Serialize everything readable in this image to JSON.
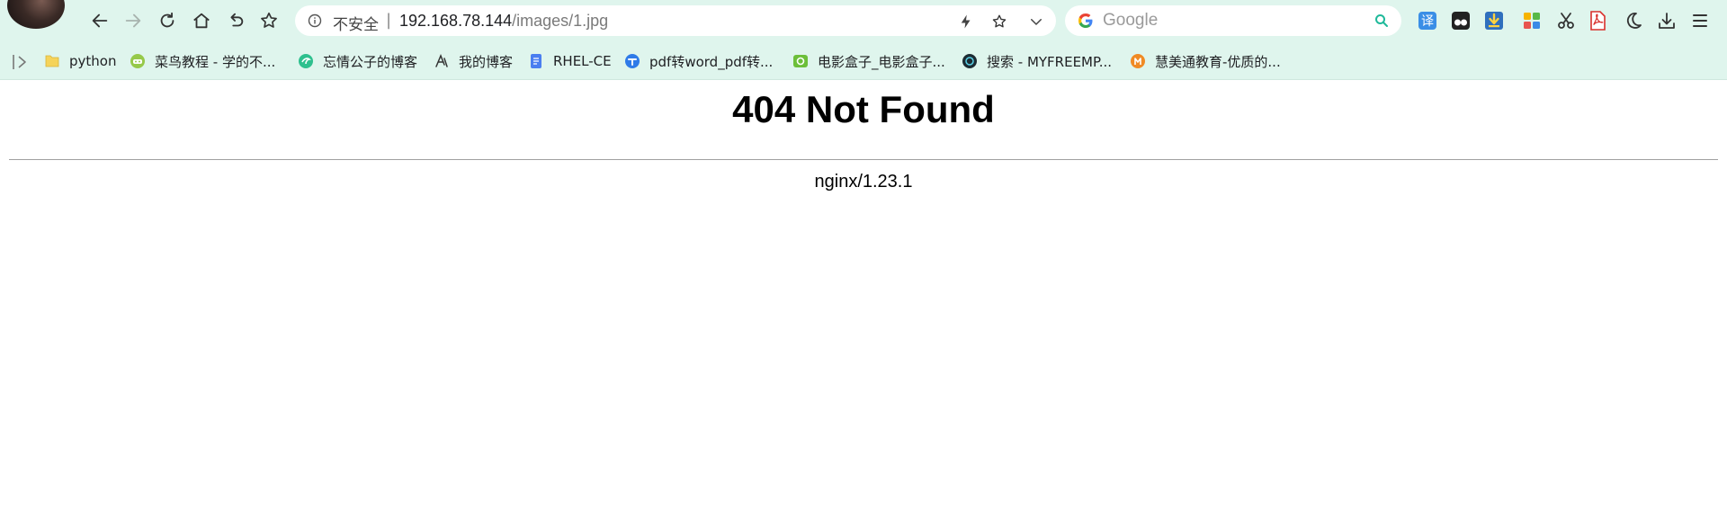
{
  "browser": {
    "omnibox": {
      "security_label": "不安全",
      "separator": "|",
      "url_host": "192.168.78.144",
      "url_path": "/images/1.jpg"
    },
    "search": {
      "placeholder": "Google"
    },
    "icons": {
      "back": "arrow-left-icon",
      "forward": "arrow-right-icon",
      "reload": "reload-icon",
      "home": "home-icon",
      "undo": "undo-icon",
      "favorite": "star-icon",
      "info": "info-icon",
      "lightning": "lightning-icon",
      "bookmark_star": "star-icon",
      "dropdown": "chevron-down-icon",
      "search_go": "search-icon",
      "translate": "translate-icon",
      "tampermonkey": "tampermonkey-icon",
      "idm": "download-manager-icon",
      "apps": "apps-grid-icon",
      "screenshot": "scissors-icon",
      "pdf": "pdf-icon",
      "dark_mode": "moon-icon",
      "downloads": "download-icon",
      "menu": "menu-icon"
    },
    "extensions": {
      "translate_glyph": "译"
    },
    "colors": {
      "toolbar_bg": "#dff5ed",
      "page_bg": "#ffffff",
      "search_accent": "#1fb99a"
    }
  },
  "bookmarks": [
    {
      "label": "python",
      "icon": "folder-icon"
    },
    {
      "label": "菜鸟教程 - 学的不...",
      "icon": "runoob-icon"
    },
    {
      "label": "忘情公子的博客",
      "icon": "blog-icon"
    },
    {
      "label": "我的博客",
      "icon": "my-blog-icon"
    },
    {
      "label": "RHEL-CE",
      "icon": "doc-icon"
    },
    {
      "label": "pdf转word_pdf转...",
      "icon": "pdf-convert-icon"
    },
    {
      "label": "电影盒子_电影盒子...",
      "icon": "movie-box-icon"
    },
    {
      "label": "搜索 - MYFREEMP...",
      "icon": "myfreemp3-icon"
    },
    {
      "label": "慧美通教育-优质的...",
      "icon": "education-icon"
    }
  ],
  "page": {
    "title": "404 Not Found",
    "server_signature": "nginx/1.23.1"
  }
}
